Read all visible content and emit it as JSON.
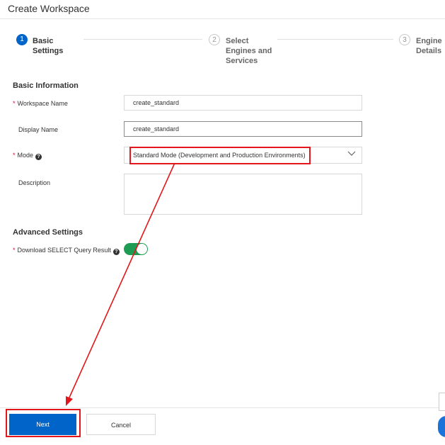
{
  "window": {
    "title": "Create Workspace"
  },
  "steps": [
    {
      "number": "1",
      "label": "Basic\nSettings",
      "state": "active"
    },
    {
      "number": "2",
      "label": "Select\nEngines and\nServices",
      "state": "inactive"
    },
    {
      "number": "3",
      "label": "Engine\nDetails",
      "state": "inactive"
    }
  ],
  "basic_info": {
    "heading": "Basic Information",
    "workspace_name": {
      "label": "Workspace Name",
      "required": "*",
      "value": "create_standard"
    },
    "display_name": {
      "label": "Display Name",
      "value": "create_standard"
    },
    "mode": {
      "label": "Mode",
      "required": "*",
      "value": "Standard Mode (Development and Production Environments)",
      "help_icon": "?"
    },
    "description": {
      "label": "Description",
      "value": ""
    }
  },
  "advanced": {
    "heading": "Advanced Settings",
    "download_select": {
      "label": "Download SELECT Query Result",
      "required": "*",
      "help_icon": "?",
      "enabled": true
    }
  },
  "footer": {
    "next_label": "Next",
    "cancel_label": "Cancel"
  },
  "colors": {
    "primary": "#0064c8",
    "toggle_on": "#1f9c54",
    "annotation": "#e3161b",
    "required": "#ee0033"
  }
}
